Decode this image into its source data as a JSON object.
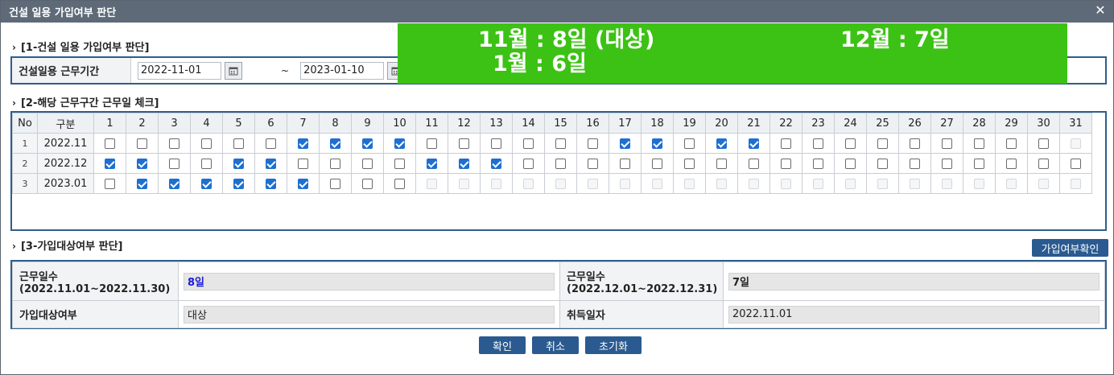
{
  "window": {
    "title": "건설 일용 가입여부 판단",
    "close_icon": "close-icon"
  },
  "section1": {
    "title": "[1-건설 일용 가입여부 판단]"
  },
  "period": {
    "label": "건설일용 근무기간",
    "start": "2022-11-01",
    "end": "2023-01-10",
    "separator": "~"
  },
  "banner": {
    "line1a": "11월 : 8일 (대상)",
    "line1b": "12월 : 7일",
    "line2": "1월 : 6일",
    "background": "#3cc214"
  },
  "section2": {
    "title": "[2-해당 근무구간 근무일 체크]"
  },
  "grid": {
    "headers": {
      "no": "No",
      "ym": "구분"
    },
    "days": [
      "1",
      "2",
      "3",
      "4",
      "5",
      "6",
      "7",
      "8",
      "9",
      "10",
      "11",
      "12",
      "13",
      "14",
      "15",
      "16",
      "17",
      "18",
      "19",
      "20",
      "21",
      "22",
      "23",
      "24",
      "25",
      "26",
      "27",
      "28",
      "29",
      "30",
      "31"
    ],
    "rows": [
      {
        "no": "1",
        "ym": "2022.11",
        "checked": [
          7,
          8,
          9,
          10,
          17,
          18,
          20,
          21
        ],
        "disabled": [
          31
        ]
      },
      {
        "no": "2",
        "ym": "2022.12",
        "checked": [
          1,
          2,
          5,
          6,
          11,
          12,
          13
        ],
        "disabled": []
      },
      {
        "no": "3",
        "ym": "2023.01",
        "checked": [
          2,
          3,
          4,
          5,
          6,
          7
        ],
        "disabled": [
          11,
          12,
          13,
          14,
          15,
          16,
          17,
          18,
          19,
          20,
          21,
          22,
          23,
          24,
          25,
          26,
          27,
          28,
          29,
          30,
          31
        ]
      }
    ]
  },
  "section3": {
    "title": "[3-가입대상여부 판단]",
    "check_button": "가입여부확인"
  },
  "result": {
    "days1_label_a": "근무일수",
    "days1_label_b": "(2022.11.01~2022.11.30)",
    "days1_value": "8일",
    "days2_label_a": "근무일수",
    "days2_label_b": "(2022.12.01~2022.12.31)",
    "days2_value": "7일",
    "eligible_label": "가입대상여부",
    "eligible_value": "대상",
    "acq_label": "취득일자",
    "acq_value": "2022.11.01"
  },
  "buttons": {
    "ok": "확인",
    "cancel": "취소",
    "reset": "초기화"
  },
  "colors": {
    "accent": "#2a5a8f",
    "title_bar": "#5e6a78",
    "highlight_value": "#1a1ad6"
  }
}
